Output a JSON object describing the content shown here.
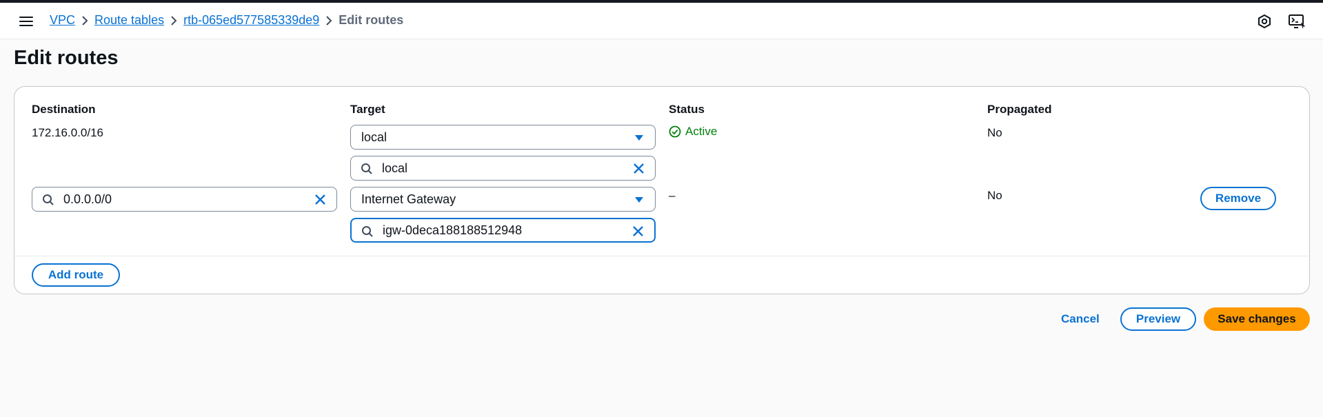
{
  "header": {
    "breadcrumbs": [
      {
        "label": "VPC"
      },
      {
        "label": "Route tables"
      },
      {
        "label": "rtb-065ed577585339de9"
      },
      {
        "label": "Edit routes"
      }
    ]
  },
  "page": {
    "title": "Edit routes"
  },
  "table": {
    "columns": [
      "Destination",
      "Target",
      "Status",
      "Propagated"
    ],
    "rows": [
      {
        "destination": "172.16.0.0/16",
        "target_type": "local",
        "target_search": "local",
        "status": "Active",
        "propagated": "No"
      },
      {
        "destination": "0.0.0.0/0",
        "target_type": "Internet Gateway",
        "target_search": "igw-0deca188188512948",
        "status": "–",
        "propagated": "No",
        "remove_label": "Remove"
      }
    ],
    "add_route_label": "Add route"
  },
  "actions": {
    "cancel_label": "Cancel",
    "preview_label": "Preview",
    "save_label": "Save changes"
  },
  "colors": {
    "link": "#0972d3",
    "success": "#037f0c",
    "primary_button": "#ff9900"
  },
  "icons": [
    "menu-icon",
    "chevron-right-icon",
    "feedback-icon",
    "cloudshell-icon",
    "search-icon",
    "clear-icon",
    "caret-down-icon",
    "status-success-icon"
  ]
}
